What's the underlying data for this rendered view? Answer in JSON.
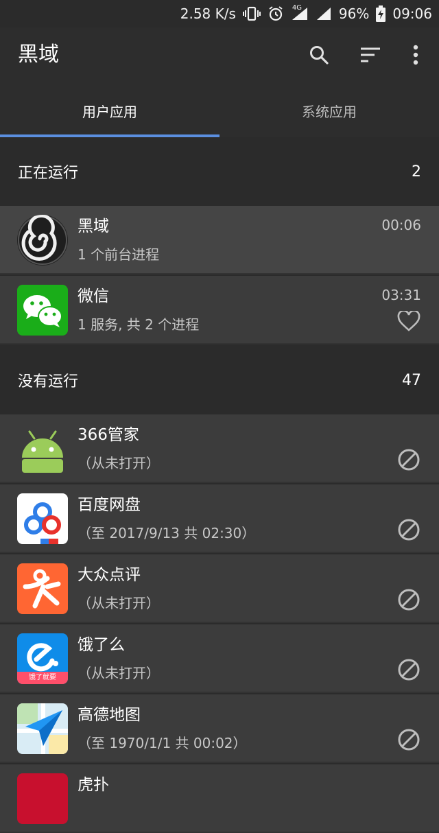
{
  "status_bar": {
    "speed": "2.58 K/s",
    "network": "4G",
    "battery": "96%",
    "time": "09:06",
    "icons": [
      "vibrate-icon",
      "alarm-icon",
      "signal-4g-icon",
      "signal-icon",
      "battery-charging-icon"
    ]
  },
  "app_bar": {
    "title": "黑域",
    "actions": [
      "search-icon",
      "sort-icon",
      "more-vert-icon"
    ]
  },
  "tabs": [
    {
      "label": "用户应用",
      "active": true
    },
    {
      "label": "系统应用",
      "active": false
    }
  ],
  "running": {
    "title": "正在运行",
    "count": "2",
    "apps": [
      {
        "name": "黑域",
        "detail": "1 个前台进程",
        "time": "00:06",
        "icon": "brevent-icon"
      },
      {
        "name": "微信",
        "detail": "1 服务, 共 2 个进程",
        "time": "03:31",
        "icon": "wechat-icon",
        "action": "heart-icon"
      }
    ]
  },
  "not_running": {
    "title": "没有运行",
    "count": "47",
    "apps": [
      {
        "name": "366管家",
        "detail": "（从未打开）",
        "icon": "android-icon",
        "action": "block-icon"
      },
      {
        "name": "百度网盘",
        "detail": "（至 2017/9/13 共 02:30）",
        "icon": "baidu-netdisk-icon",
        "action": "block-icon"
      },
      {
        "name": "大众点评",
        "detail": "（从未打开）",
        "icon": "dianping-icon",
        "action": "block-icon"
      },
      {
        "name": "饿了么",
        "detail": "（从未打开）",
        "icon": "eleme-icon",
        "action": "block-icon",
        "icon_text": "饿了就要"
      },
      {
        "name": "高德地图",
        "detail": "（至 1970/1/1 共 00:02）",
        "icon": "amap-icon",
        "action": "block-icon"
      },
      {
        "name": "虎扑",
        "detail": "",
        "icon": "hupu-icon"
      }
    ]
  },
  "colors": {
    "background": "#2b2b2b",
    "row": "#3c3c3c",
    "accent": "#5b8fe0",
    "wechat": "#1aad19",
    "dianping": "#ff6633"
  }
}
